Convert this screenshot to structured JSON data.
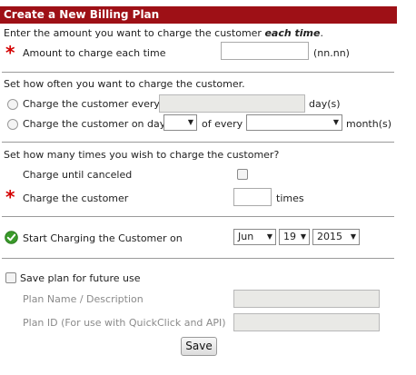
{
  "title": "Create a New Billing Plan",
  "amount": {
    "intro_prefix": "Enter the amount you want to charge the customer ",
    "intro_emphasis": "each time",
    "intro_suffix": ".",
    "label": "Amount to charge each time",
    "value": "",
    "format_hint": "(nn.nn)"
  },
  "frequency": {
    "heading": "Set how often you want to charge the customer.",
    "option_every_label": "Charge the customer every",
    "days_unit": "day(s)",
    "option_on_day_label": "Charge the customer on day",
    "of_every_label": "of every",
    "months_unit": "month(s)",
    "day_select_value": "",
    "month_select_value": ""
  },
  "count": {
    "heading": "Set how many times you wish to charge the customer?",
    "until_canceled_label": "Charge until canceled",
    "charge_label": "Charge the customer",
    "times_value": "",
    "times_unit": "times"
  },
  "start": {
    "label": "Start Charging the Customer on",
    "month": "Jun",
    "day": "19",
    "year": "2015"
  },
  "save_plan": {
    "checkbox_label": "Save plan for future use",
    "name_label": "Plan Name / Description",
    "id_label": "Plan ID (For use with QuickClick and API)",
    "name_value": "",
    "id_value": ""
  },
  "save_button": "Save",
  "icons": {
    "required": "asterisk",
    "start": "green-checkmark-circle"
  },
  "colors": {
    "title_bar": "#9e1016",
    "required": "#d40000",
    "check_green": "#3a9a2a"
  }
}
